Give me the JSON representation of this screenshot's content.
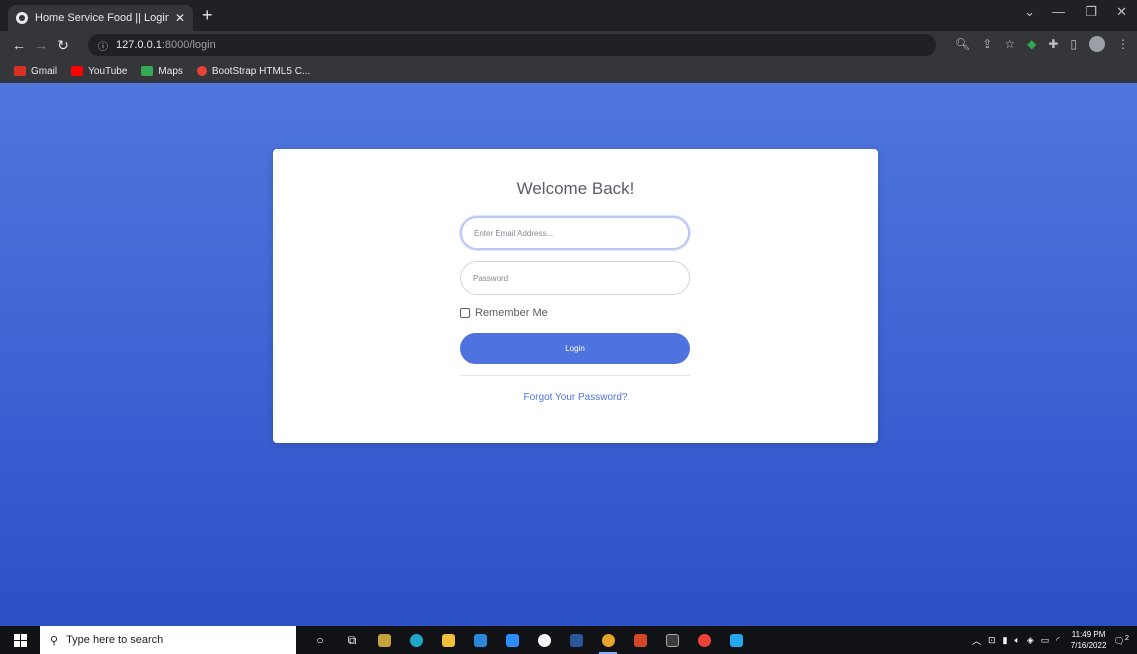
{
  "browser": {
    "tab_title": "Home Service Food || Login Page",
    "tab_close": "✕",
    "new_tab": "+",
    "url_host": "127.0.0.1",
    "url_path": ":8000/login",
    "bookmarks": [
      {
        "label": "Gmail",
        "color": "#d93025"
      },
      {
        "label": "YouTube",
        "color": "#ff0000"
      },
      {
        "label": "Maps",
        "color": "#34a853"
      },
      {
        "label": "BootStrap HTML5 C...",
        "color": "#ea4335"
      }
    ]
  },
  "login": {
    "heading": "Welcome Back!",
    "email_placeholder": "Enter Email Address...",
    "password_placeholder": "Password",
    "remember_label": "Remember Me",
    "login_label": "Login",
    "forgot_label": "Forgot Your Password?"
  },
  "taskbar": {
    "search_placeholder": "Type here to search",
    "time": "11:49 PM",
    "date": "7/16/2022",
    "notification_count": "2"
  },
  "colors": {
    "accent": "#4e73df",
    "page_gradient_top": "#4f77dc",
    "page_gradient_bottom": "#2b4fc6"
  }
}
